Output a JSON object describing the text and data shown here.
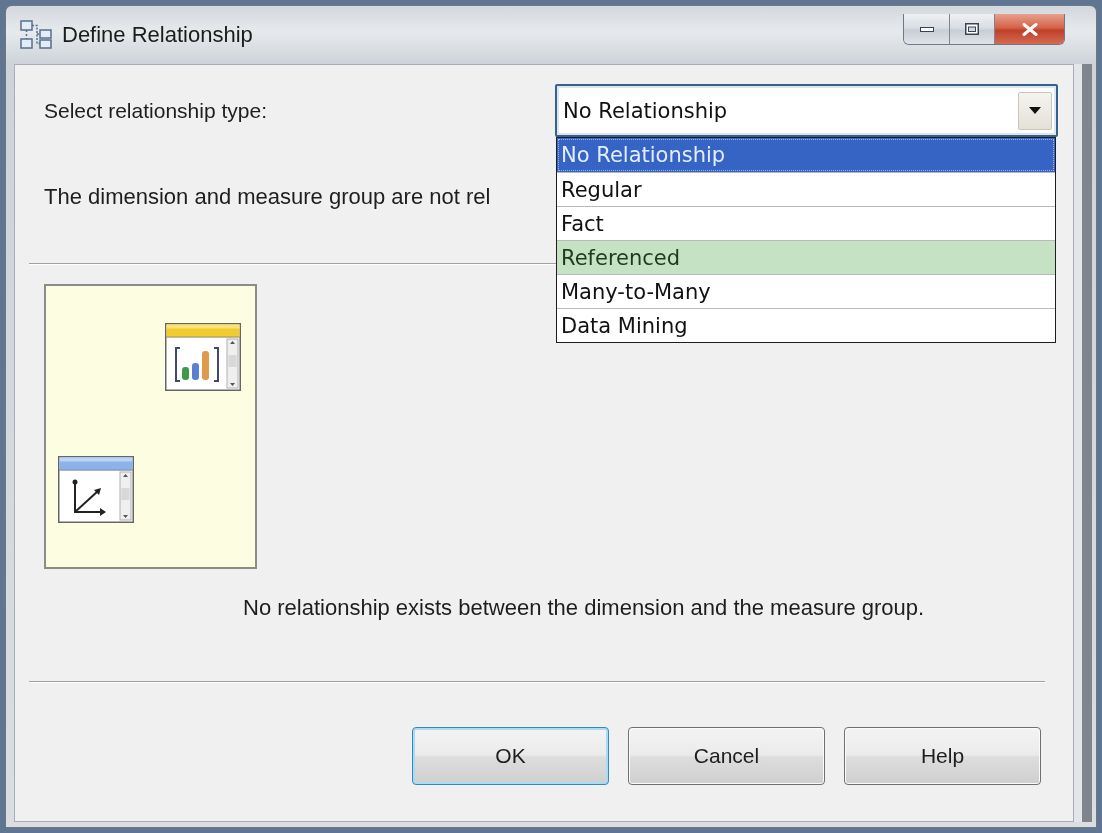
{
  "window": {
    "title": "Define Relationship"
  },
  "relationship_type": {
    "label": "Select relationship type:",
    "value": "No Relationship",
    "expanded": true,
    "options": [
      {
        "label": "No Relationship",
        "selected": true,
        "highlighted": false
      },
      {
        "label": "Regular",
        "selected": false,
        "highlighted": false
      },
      {
        "label": "Fact",
        "selected": false,
        "highlighted": false
      },
      {
        "label": "Referenced",
        "selected": false,
        "highlighted": true
      },
      {
        "label": "Many-to-Many",
        "selected": false,
        "highlighted": false
      },
      {
        "label": "Data Mining",
        "selected": false,
        "highlighted": false
      }
    ]
  },
  "status_text": "The dimension and measure group are not rel",
  "description": "No relationship exists between the dimension and the measure group.",
  "buttons": [
    {
      "label": "OK",
      "default": true
    },
    {
      "label": "Cancel",
      "default": false
    },
    {
      "label": "Help",
      "default": false
    }
  ]
}
